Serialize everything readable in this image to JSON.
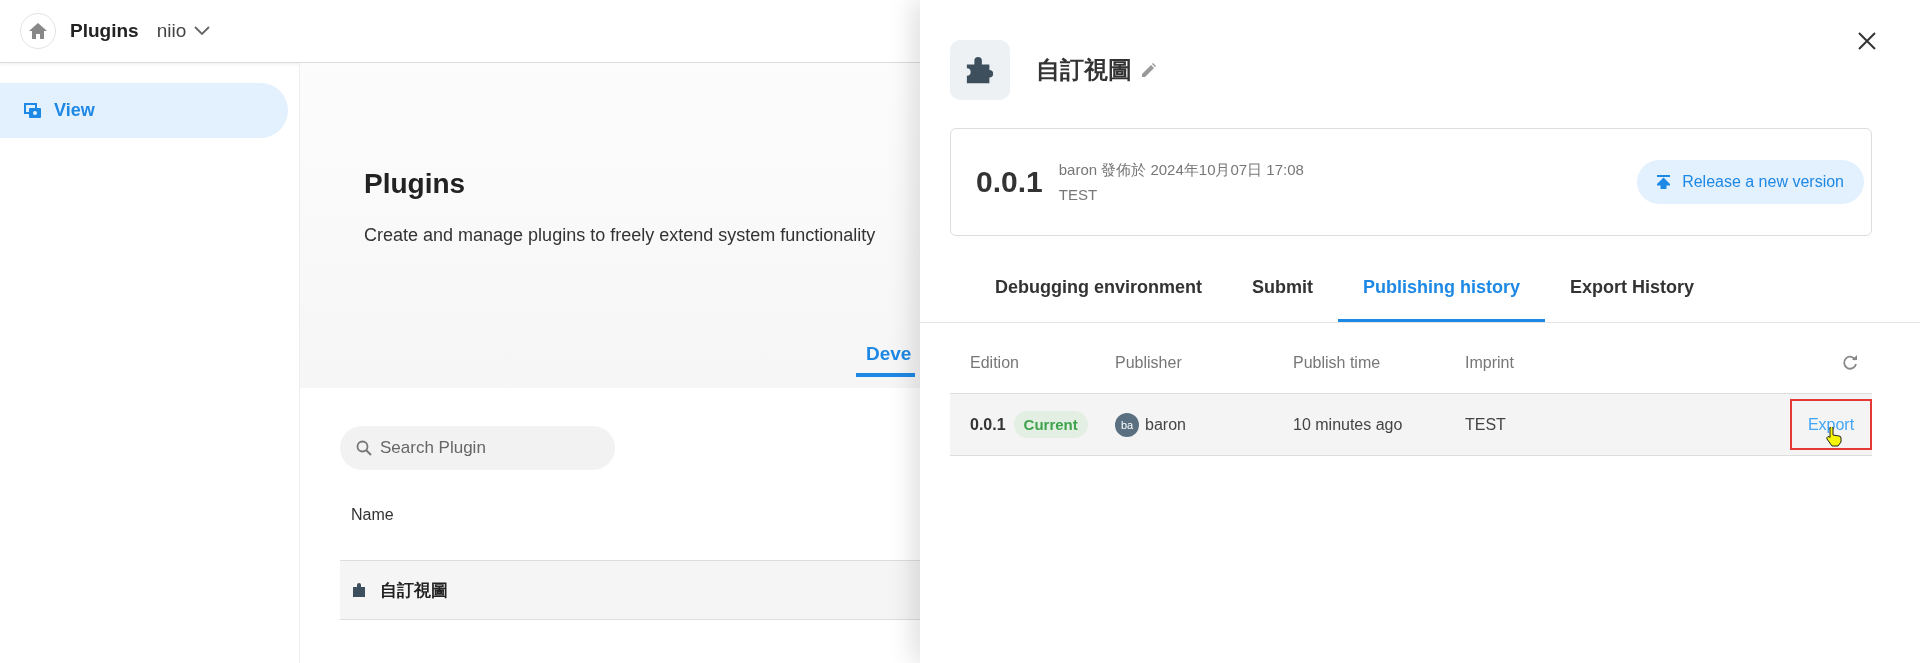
{
  "topbar": {
    "title": "Plugins",
    "workspace": "niio"
  },
  "sidebar": {
    "items": [
      {
        "label": "View",
        "selected": true
      }
    ]
  },
  "hero": {
    "title": "Plugins",
    "description": "Create and manage plugins to freely extend system functionality",
    "tab_partial": "Deve"
  },
  "search": {
    "placeholder": "Search Plugin"
  },
  "plugin_table": {
    "columns": [
      "Name"
    ],
    "rows": [
      {
        "name": "自訂視圖"
      }
    ]
  },
  "drawer": {
    "title": "自訂視圖",
    "version_card": {
      "version": "0.0.1",
      "meta": "baron 發佈於 2024年10月07日 17:08",
      "note": "TEST",
      "button": "Release a new version"
    },
    "tabs": [
      {
        "label": "Debugging environment",
        "selected": false
      },
      {
        "label": "Submit",
        "selected": false
      },
      {
        "label": "Publishing history",
        "selected": true
      },
      {
        "label": "Export History",
        "selected": false
      }
    ],
    "history": {
      "columns": [
        "Edition",
        "Publisher",
        "Publish time",
        "Imprint"
      ],
      "rows": [
        {
          "edition": "0.0.1",
          "badge": "Current",
          "avatar": "ba",
          "publisher": "baron",
          "time": "10 minutes ago",
          "imprint": "TEST",
          "action": "Export",
          "highlighted": true
        }
      ]
    }
  }
}
